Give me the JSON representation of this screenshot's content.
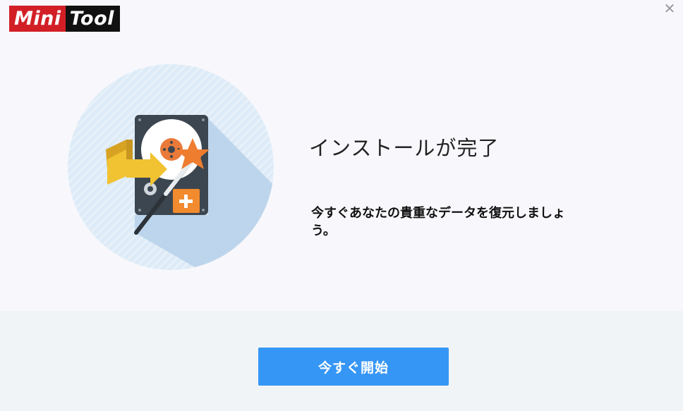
{
  "header": {
    "logo_part1": "Mini",
    "logo_part2": "Tool",
    "close_symbol": "✕"
  },
  "main": {
    "title": "インストールが完了",
    "subtitle": "今すぐあなたの貴重なデータを復元しましょう。"
  },
  "footer": {
    "start_button_label": "今すぐ開始"
  },
  "colors": {
    "accent": "#3696f5",
    "logo_red": "#d21f26",
    "logo_black": "#111111",
    "circle_bg": "#dbeaf6",
    "footer_bg": "#f1f4f6"
  },
  "icons": {
    "illustration": "hard-drive-recovery-icon",
    "close": "close-icon"
  }
}
